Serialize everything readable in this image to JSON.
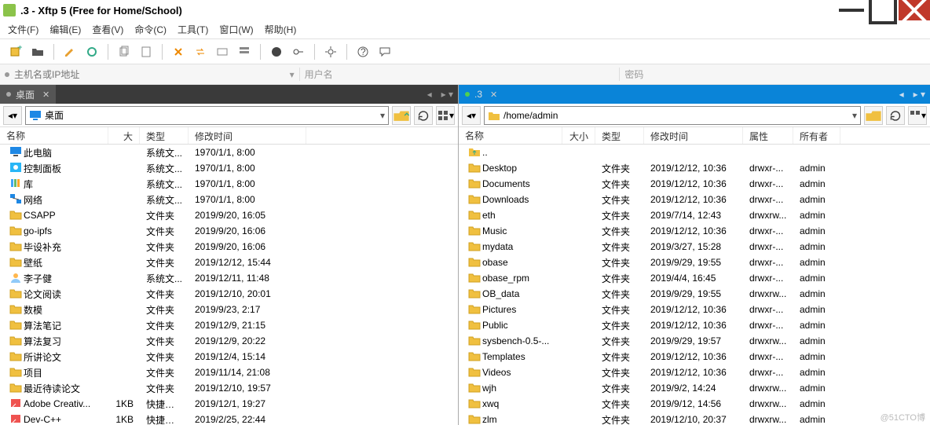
{
  "title": ".3  - Xftp 5 (Free for Home/School)",
  "menus": [
    "文件(F)",
    "编辑(E)",
    "查看(V)",
    "命令(C)",
    "工具(T)",
    "窗口(W)",
    "帮助(H)"
  ],
  "addressbar": {
    "placeholder": "主机名或IP地址",
    "user_label": "用户名",
    "pass_label": "密码"
  },
  "left": {
    "tab": "桌面",
    "path": "桌面",
    "headers": [
      "名称",
      "大小",
      "类型",
      "修改时间"
    ],
    "rows": [
      {
        "ic": "pc",
        "name": "此电脑",
        "size": "",
        "type": "系统文...",
        "date": "1970/1/1, 8:00"
      },
      {
        "ic": "cpl",
        "name": "控制面板",
        "size": "",
        "type": "系统文...",
        "date": "1970/1/1, 8:00"
      },
      {
        "ic": "lib",
        "name": "库",
        "size": "",
        "type": "系统文...",
        "date": "1970/1/1, 8:00"
      },
      {
        "ic": "net",
        "name": "网络",
        "size": "",
        "type": "系统文...",
        "date": "1970/1/1, 8:00"
      },
      {
        "ic": "folder",
        "name": "CSAPP",
        "size": "",
        "type": "文件夹",
        "date": "2019/9/20, 16:05"
      },
      {
        "ic": "folder",
        "name": "go-ipfs",
        "size": "",
        "type": "文件夹",
        "date": "2019/9/20, 16:06"
      },
      {
        "ic": "folder",
        "name": "毕设补充",
        "size": "",
        "type": "文件夹",
        "date": "2019/9/20, 16:06"
      },
      {
        "ic": "folder",
        "name": "壁纸",
        "size": "",
        "type": "文件夹",
        "date": "2019/12/12, 15:44"
      },
      {
        "ic": "user",
        "name": "李子健",
        "size": "",
        "type": "系统文...",
        "date": "2019/12/11, 11:48"
      },
      {
        "ic": "folder",
        "name": "论文阅读",
        "size": "",
        "type": "文件夹",
        "date": "2019/12/10, 20:01"
      },
      {
        "ic": "folder",
        "name": "数模",
        "size": "",
        "type": "文件夹",
        "date": "2019/9/23, 2:17"
      },
      {
        "ic": "folder",
        "name": "算法笔记",
        "size": "",
        "type": "文件夹",
        "date": "2019/12/9, 21:15"
      },
      {
        "ic": "folder",
        "name": "算法复习",
        "size": "",
        "type": "文件夹",
        "date": "2019/12/9, 20:22"
      },
      {
        "ic": "folder",
        "name": "所讲论文",
        "size": "",
        "type": "文件夹",
        "date": "2019/12/4, 15:14"
      },
      {
        "ic": "folder",
        "name": "项目",
        "size": "",
        "type": "文件夹",
        "date": "2019/11/14, 21:08"
      },
      {
        "ic": "folder",
        "name": "最近待读论文",
        "size": "",
        "type": "文件夹",
        "date": "2019/12/10, 19:57"
      },
      {
        "ic": "lnk",
        "name": "Adobe Creativ...",
        "size": "1KB",
        "type": "快捷方式",
        "date": "2019/12/1, 19:27"
      },
      {
        "ic": "lnk",
        "name": "Dev-C++",
        "size": "1KB",
        "type": "快捷方式",
        "date": "2019/2/25, 22:44"
      }
    ]
  },
  "right": {
    "tab": ".3",
    "path": "/home/admin",
    "headers": [
      "名称",
      "大小",
      "类型",
      "修改时间",
      "属性",
      "所有者"
    ],
    "rows": [
      {
        "ic": "up",
        "name": "..",
        "size": "",
        "type": "",
        "date": "",
        "attr": "",
        "owner": ""
      },
      {
        "ic": "folder",
        "name": "Desktop",
        "size": "",
        "type": "文件夹",
        "date": "2019/12/12, 10:36",
        "attr": "drwxr-...",
        "owner": "admin"
      },
      {
        "ic": "folder",
        "name": "Documents",
        "size": "",
        "type": "文件夹",
        "date": "2019/12/12, 10:36",
        "attr": "drwxr-...",
        "owner": "admin"
      },
      {
        "ic": "folder",
        "name": "Downloads",
        "size": "",
        "type": "文件夹",
        "date": "2019/12/12, 10:36",
        "attr": "drwxr-...",
        "owner": "admin"
      },
      {
        "ic": "folder",
        "name": "eth",
        "size": "",
        "type": "文件夹",
        "date": "2019/7/14, 12:43",
        "attr": "drwxrw...",
        "owner": "admin"
      },
      {
        "ic": "folder",
        "name": "Music",
        "size": "",
        "type": "文件夹",
        "date": "2019/12/12, 10:36",
        "attr": "drwxr-...",
        "owner": "admin"
      },
      {
        "ic": "folder",
        "name": "mydata",
        "size": "",
        "type": "文件夹",
        "date": "2019/3/27, 15:28",
        "attr": "drwxr-...",
        "owner": "admin"
      },
      {
        "ic": "folder",
        "name": "obase",
        "size": "",
        "type": "文件夹",
        "date": "2019/9/29, 19:55",
        "attr": "drwxr-...",
        "owner": "admin"
      },
      {
        "ic": "folder",
        "name": "obase_rpm",
        "size": "",
        "type": "文件夹",
        "date": "2019/4/4, 16:45",
        "attr": "drwxr-...",
        "owner": "admin"
      },
      {
        "ic": "folder",
        "name": "OB_data",
        "size": "",
        "type": "文件夹",
        "date": "2019/9/29, 19:55",
        "attr": "drwxrw...",
        "owner": "admin"
      },
      {
        "ic": "folder",
        "name": "Pictures",
        "size": "",
        "type": "文件夹",
        "date": "2019/12/12, 10:36",
        "attr": "drwxr-...",
        "owner": "admin"
      },
      {
        "ic": "folder",
        "name": "Public",
        "size": "",
        "type": "文件夹",
        "date": "2019/12/12, 10:36",
        "attr": "drwxr-...",
        "owner": "admin"
      },
      {
        "ic": "folder",
        "name": "sysbench-0.5-...",
        "size": "",
        "type": "文件夹",
        "date": "2019/9/29, 19:57",
        "attr": "drwxrw...",
        "owner": "admin"
      },
      {
        "ic": "folder",
        "name": "Templates",
        "size": "",
        "type": "文件夹",
        "date": "2019/12/12, 10:36",
        "attr": "drwxr-...",
        "owner": "admin"
      },
      {
        "ic": "folder",
        "name": "Videos",
        "size": "",
        "type": "文件夹",
        "date": "2019/12/12, 10:36",
        "attr": "drwxr-...",
        "owner": "admin"
      },
      {
        "ic": "folder",
        "name": "wjh",
        "size": "",
        "type": "文件夹",
        "date": "2019/9/2, 14:24",
        "attr": "drwxrw...",
        "owner": "admin"
      },
      {
        "ic": "folder",
        "name": "xwq",
        "size": "",
        "type": "文件夹",
        "date": "2019/9/12, 14:56",
        "attr": "drwxrw...",
        "owner": "admin"
      },
      {
        "ic": "folder",
        "name": "zlm",
        "size": "",
        "type": "文件夹",
        "date": "2019/12/10, 20:37",
        "attr": "drwxrw...",
        "owner": "admin"
      }
    ]
  },
  "watermark": "@51CTO博"
}
